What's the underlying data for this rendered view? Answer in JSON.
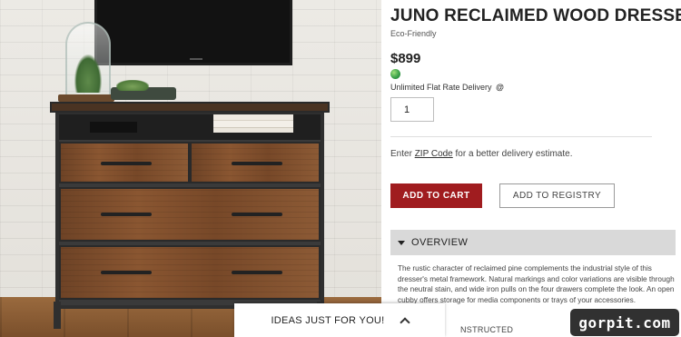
{
  "product": {
    "title": "JUNO RECLAIMED WOOD DRESSER",
    "tag": "Eco-Friendly",
    "price": "$899",
    "delivery": "Unlimited Flat Rate Delivery",
    "delivery_help_icon": "@",
    "quantity": "1"
  },
  "zip": {
    "prefix": "Enter ",
    "link": "ZIP Code",
    "suffix": " for a better delivery estimate."
  },
  "actions": {
    "add_to_cart": "ADD TO CART",
    "add_to_registry": "ADD TO REGISTRY"
  },
  "overview": {
    "label": "OVERVIEW",
    "description": "The rustic character of reclaimed pine complements the industrial style of this dresser's metal framework. Natural markings and color variations are visible through the neutral stain, and wide iron pulls on the four drawers complete the look. An open cubby offers storage for media components or trays of your accessories.",
    "next_section": "NSTRUCTED"
  },
  "ideas_drawer": {
    "label": "IDEAS JUST FOR YOU!"
  },
  "watermark": {
    "text": "gorpit.com"
  },
  "colors": {
    "accent": "#a01c1f",
    "overview_bg": "#d9d9d9"
  }
}
